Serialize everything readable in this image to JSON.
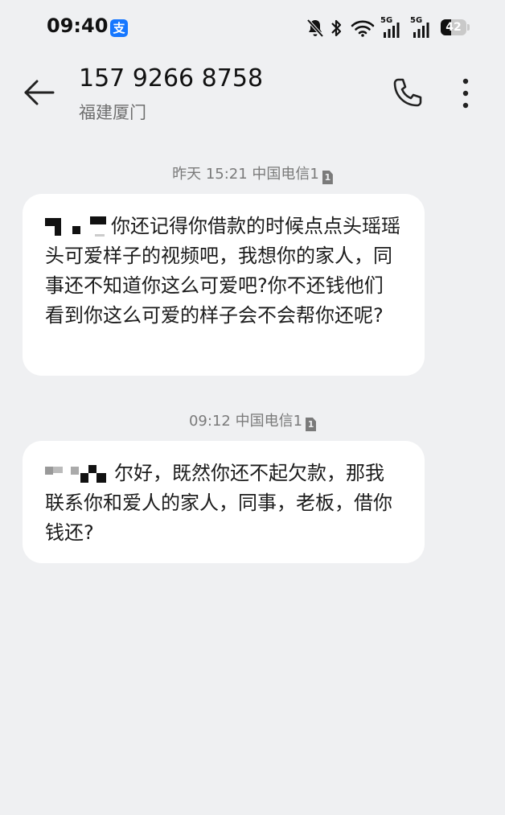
{
  "status_bar": {
    "time": "09:40",
    "app_badge_icon": "alipay-icon",
    "app_badge_char": "支",
    "network_1": "5G",
    "network_2": "5G",
    "battery_level": "42",
    "icons": [
      "mute-bell-icon",
      "bluetooth-icon",
      "wifi-icon",
      "signal-icon",
      "signal-icon",
      "battery-icon"
    ]
  },
  "header": {
    "contact_number": "157 9266 8758",
    "contact_location": "福建厦门",
    "back_icon": "back-arrow-icon",
    "call_icon": "phone-icon",
    "more_icon": "more-vertical-icon"
  },
  "messages": [
    {
      "timestamp": "昨天 15:21 中国电信1",
      "sim": "1",
      "text": "你还记得你借款的时候点点头瑶瑶头可爱样子的视频吧，我想你的家人，同事还不知道你这么可爱吧?你不还钱他们看到你这么可爱的样子会不会帮你还呢?"
    },
    {
      "timestamp": "09:12 中国电信1",
      "sim": "1",
      "text": "尔好，既然你还不起欠款，那我联系你和爱人的家人，同事，老板，借你钱还?"
    }
  ],
  "colors": {
    "background": "#eff0f2",
    "bubble": "#ffffff",
    "alipay": "#1677ff",
    "secondary_text": "#7a7a7a"
  }
}
